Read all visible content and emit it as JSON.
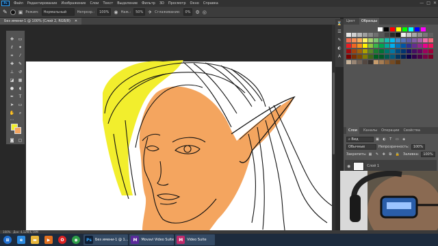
{
  "menubar": {
    "logo": "Ps",
    "items": [
      "Файл",
      "Редактирование",
      "Изображение",
      "Слои",
      "Текст",
      "Выделение",
      "Фильтр",
      "3D",
      "Просмотр",
      "Окно",
      "Справка"
    ],
    "window_controls": [
      "—",
      "□",
      "✕"
    ]
  },
  "options": {
    "mode_label": "Режим:",
    "mode_value": "Нормальный",
    "opacity_label": "Непрозр.:",
    "opacity_value": "100%",
    "pressure_label": "Наж.:",
    "pressure_value": "50%",
    "smoothing_label": "Сглаживание:",
    "smoothing_value": "0%"
  },
  "doc_tab": {
    "title": "Без имени-1 @ 100% (Слой 2, RGB/8)",
    "close": "✕"
  },
  "colors": {
    "foreground": "#f2ee2d",
    "background": "#f4a55f"
  },
  "panels": {
    "top_tabs": [
      "Цвет",
      "Образцы"
    ],
    "layer_tabs": [
      "Слои",
      "Каналы",
      "Операции",
      "Свойства"
    ],
    "kind_label": "Вид",
    "blend_mode": "Обычные",
    "opacity_label": "Непрозрачность:",
    "opacity_value": "100%",
    "lock_label": "Закрепить:",
    "fill_label": "Заливка:",
    "fill_value": "100%",
    "layer_name": "Слой 1"
  },
  "status": {
    "zoom": "100%",
    "doc_info": "Док: 4,12M/6,59M"
  },
  "taskbar": {
    "items": [
      {
        "icon": "start-icon",
        "label": ""
      },
      {
        "icon": "ie-icon",
        "label": ""
      },
      {
        "icon": "folder-icon",
        "label": ""
      },
      {
        "icon": "media-icon",
        "label": ""
      },
      {
        "icon": "opera-icon",
        "label": ""
      },
      {
        "icon": "chrome-icon",
        "label": ""
      },
      {
        "icon": "photoshop-icon",
        "label": "Без имени-1 @ 1..."
      },
      {
        "icon": "movavi-icon",
        "label": "Movavi Video Suite"
      },
      {
        "icon": "movavi-icon",
        "label": "Video Suite"
      }
    ]
  }
}
